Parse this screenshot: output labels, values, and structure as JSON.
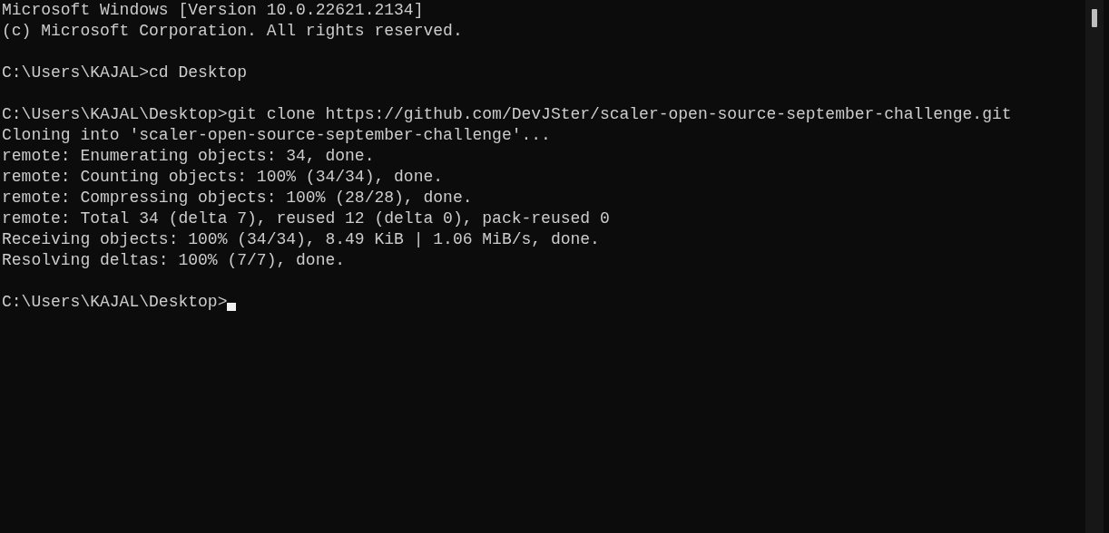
{
  "console": {
    "blocks": [
      [
        "Microsoft Windows [Version 10.0.22621.2134]",
        "(c) Microsoft Corporation. All rights reserved."
      ],
      [
        "C:\\Users\\KAJAL>cd Desktop"
      ],
      [
        "C:\\Users\\KAJAL\\Desktop>git clone https://github.com/DevJSter/scaler-open-source-september-challenge.git",
        "Cloning into 'scaler-open-source-september-challenge'...",
        "remote: Enumerating objects: 34, done.",
        "remote: Counting objects: 100% (34/34), done.",
        "remote: Compressing objects: 100% (28/28), done.",
        "remote: Total 34 (delta 7), reused 12 (delta 0), pack-reused 0",
        "Receiving objects: 100% (34/34), 8.49 KiB | 1.06 MiB/s, done.",
        "Resolving deltas: 100% (7/7), done."
      ]
    ],
    "prompt": "C:\\Users\\KAJAL\\Desktop>",
    "cursor_visible": true
  }
}
